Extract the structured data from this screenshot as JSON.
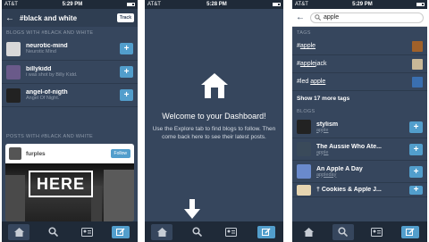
{
  "status": {
    "carrier": "AT&T",
    "left_time": "5:29 PM",
    "middle_time": "5:28 PM",
    "right_time": "5:29 PM"
  },
  "screen1": {
    "title": "#black and white",
    "track_label": "Track",
    "blogs_header": "BLOGS WITH #BLACK AND WHITE",
    "blogs": [
      {
        "name": "neurotic-mind",
        "subtitle": "Neurotic Mind",
        "color": "#d8d8d8"
      },
      {
        "name": "billykidd",
        "subtitle": "i was shot by Billy Kidd.",
        "color": "#6a5a8a"
      },
      {
        "name": "angel-of-nigth",
        "subtitle": "Angel Of Night.",
        "color": "#222222"
      }
    ],
    "posts_header": "POSTS WITH #BLACK AND WHITE",
    "post": {
      "author": "furples",
      "follow_label": "Follow",
      "image_text": "HERE"
    }
  },
  "screen2": {
    "title": "Welcome to your Dashboard!",
    "body": "Use the Explore tab to find blogs to follow. Then come back here to see their latest posts."
  },
  "screen3": {
    "search_value": "apple",
    "tags_header": "TAGS",
    "tags": [
      {
        "prefix": "#",
        "match": "apple",
        "suffix": "",
        "color": "#a0612a"
      },
      {
        "prefix": "#",
        "match": "apple",
        "suffix": "jack",
        "color": "#c9b898"
      },
      {
        "prefix": "#led ",
        "match": "apple",
        "suffix": "",
        "color": "#3a6fb0"
      }
    ],
    "show_more": "Show 17 more tags",
    "blogs_header": "BLOGS",
    "blogs": [
      {
        "name": "stylism",
        "url": "apple",
        "color": "#222222"
      },
      {
        "name": "The Aussie Who Ate...",
        "url": "apple",
        "color": "#3a4a5a"
      },
      {
        "name": "An Apple A Day",
        "url": "appleday",
        "color": "#6a8acc"
      },
      {
        "name": "† Cookies & Apple J...",
        "url": "",
        "color": "#e6d4b0"
      }
    ]
  },
  "tabbar": {
    "icons": [
      "home-icon",
      "search-icon",
      "account-icon",
      "compose-icon"
    ]
  },
  "colors": {
    "background": "#36465d",
    "accent": "#529ecc",
    "statusbar": "#1f2a38"
  }
}
